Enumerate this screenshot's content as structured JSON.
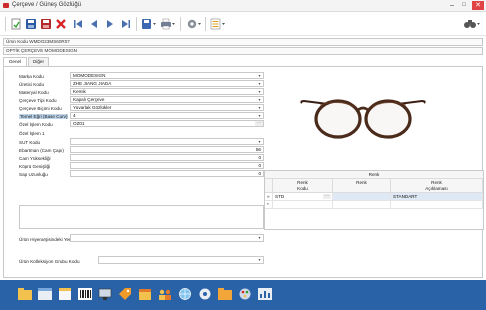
{
  "window": {
    "title": "Çerçeve / Güneş Gözlüğü",
    "minimize": "–",
    "maximize": "□",
    "close": "✕"
  },
  "toolbar": {
    "icons": [
      "new-document-icon",
      "save-icon",
      "save-as-icon",
      "delete-icon",
      "first-record-icon",
      "previous-record-icon",
      "next-record-icon",
      "last-record-icon",
      "save-dropdown-icon",
      "print-icon",
      "settings-icon",
      "list-icon",
      "binoculars-icon"
    ]
  },
  "header": {
    "code_line": "Ürün Kodu  WMDO23MS60R07",
    "name_line": "OPTİK ÇERÇEVE MOMODESIGN"
  },
  "tabs": [
    {
      "label": "Genel",
      "active": true
    },
    {
      "label": "Diğer",
      "active": false
    }
  ],
  "fields": {
    "marka_label": "Marka Kodu",
    "marka_value": "MOMODESIGN",
    "uretici_label": "Üretici Kodu",
    "uretici_value": "ZHE JIANG JIADA",
    "materyal_label": "Materyal Kodu",
    "materyal_value": "Kemik",
    "tip_label": "Çerçeve Tipi Kodu",
    "tip_value": "Kapalı Çerçeve",
    "bicim_label": "Çerçeve Biçimi Kodu",
    "bicim_value": "Yuvarlak Gözlükler",
    "temel_label": "Temel Eğri (Base Curv)",
    "temel_value": "4",
    "ozel_kod_label": "Özel İşlem Kodu",
    "ozel_kod_value": "OZ01",
    "ozel1_label": "Özel İşlem 1",
    "sut_label": "SUT Kodu",
    "ebat_label": "Ebartman (Cam Çapı)",
    "ebat_value": "56",
    "yukseklik_label": "Cam Yüksekliği",
    "yukseklik_value": "0",
    "kopru_label": "Köprü Genişliği",
    "kopru_value": "0",
    "sap_label": "Sap Uzunluğu",
    "sap_value": "0",
    "hier_label": "Ürün Hiyerarşisindeki Yeri",
    "koll_label": "Ürün Kolleksiyon Grubu Kodu"
  },
  "renk_grid": {
    "group_header": "Renk",
    "col_kod": "Renk\nKodu",
    "col_renk": "Renk",
    "col_aciklama": "Renk\nAçıklaması",
    "rows": [
      {
        "marker": "»",
        "kod": "STD",
        "renk": "",
        "aciklama": "STANDART"
      },
      {
        "marker": "*",
        "kod": "",
        "renk": "",
        "aciklama": ""
      }
    ]
  },
  "bottom_bar": {
    "icons": [
      "folder-icon",
      "window-icon",
      "document-icon",
      "barcode-icon",
      "monitor-icon",
      "tag-icon",
      "calendar-icon",
      "people-icon",
      "globe-icon",
      "color-wheel-icon",
      "folder-open-icon",
      "palette-icon",
      "dashboard-icon"
    ]
  },
  "colors": {
    "bottom_bar": "#2a62a8",
    "highlight_label": "#bcd4ea",
    "close_button": "#e04343"
  }
}
